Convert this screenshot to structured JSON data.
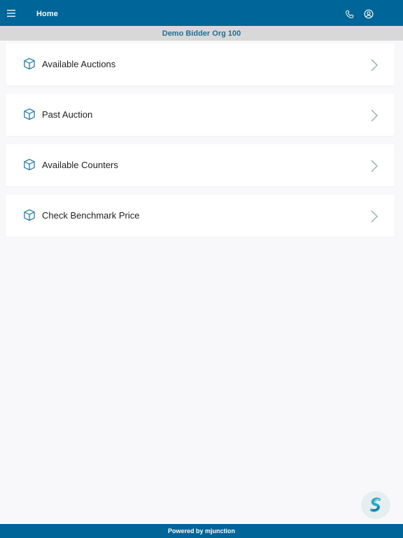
{
  "header": {
    "title": "Home",
    "menu_icon": "hamburger-menu-icon",
    "phone_icon": "phone-icon",
    "profile_icon": "user-circle-icon"
  },
  "org_bar": {
    "name": "Demo Bidder Org 100"
  },
  "menu": {
    "items": [
      {
        "label": "Available Auctions",
        "icon": "cube-icon"
      },
      {
        "label": "Past Auction",
        "icon": "cube-icon"
      },
      {
        "label": "Available Counters",
        "icon": "cube-icon"
      },
      {
        "label": "Check Benchmark Price",
        "icon": "cube-icon"
      }
    ]
  },
  "fab": {
    "icon": "brand-logo-icon"
  },
  "footer": {
    "text": "Powered by mjunction"
  },
  "colors": {
    "primary": "#006699",
    "org_text": "#1f6f97",
    "org_bar_bg": "#d8d8d8",
    "page_bg": "#f8f8fb",
    "icon": "#2a7fae"
  }
}
